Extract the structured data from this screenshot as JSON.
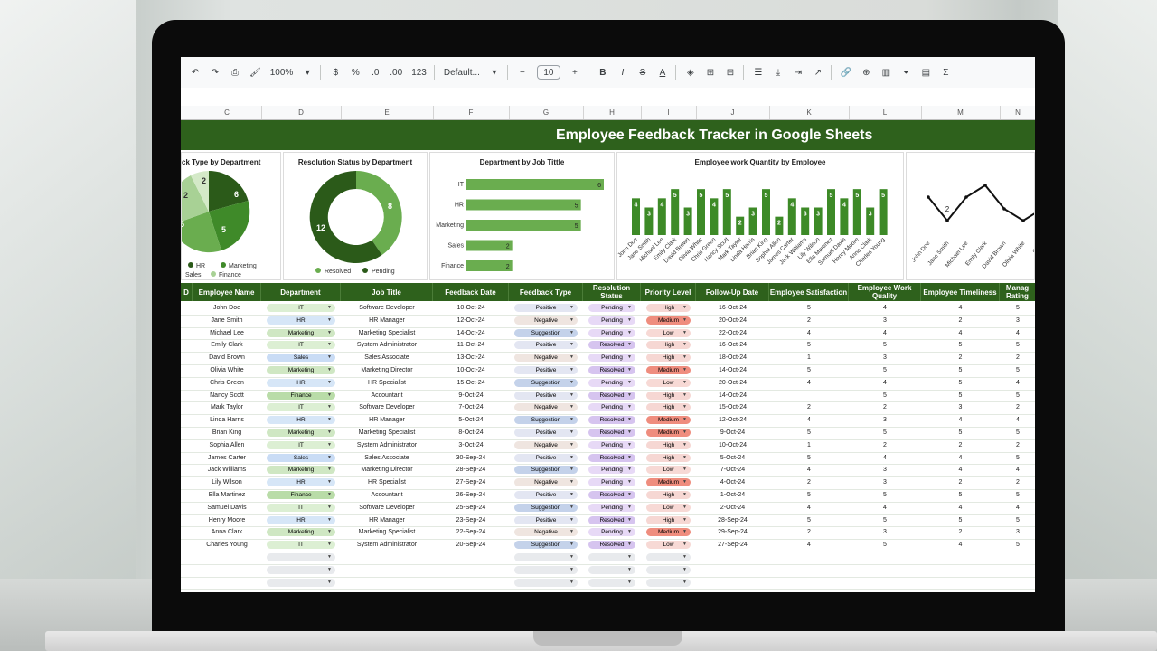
{
  "toolbar": {
    "zoom": "100%",
    "currency": "$",
    "percent": "%",
    "dec_minus": ".0",
    "dec_plus": ".00",
    "num_format": "123",
    "font": "Default...",
    "font_size": "10"
  },
  "columns": [
    {
      "label": "C",
      "w": 76
    },
    {
      "label": "D",
      "w": 88
    },
    {
      "label": "E",
      "w": 102
    },
    {
      "label": "F",
      "w": 84
    },
    {
      "label": "G",
      "w": 82
    },
    {
      "label": "H",
      "w": 64
    },
    {
      "label": "I",
      "w": 61
    },
    {
      "label": "J",
      "w": 81
    },
    {
      "label": "K",
      "w": 88
    },
    {
      "label": "L",
      "w": 80
    },
    {
      "label": "M",
      "w": 87
    },
    {
      "label": "N",
      "w": 40
    }
  ],
  "title": "Employee Feedback Tracker in Google Sheets",
  "charts": [
    {
      "title": "ck Type by Department",
      "type": "pie",
      "labels": [
        "6",
        "5",
        "5",
        "2",
        "2"
      ],
      "legend": [
        "HR",
        "Marketing",
        "Sales",
        "Finance"
      ]
    },
    {
      "title": "Resolution Status by Department",
      "type": "donut",
      "values": [
        8,
        12
      ],
      "legend": [
        "Resolved",
        "Pending"
      ]
    },
    {
      "title": "Department by Job Tittle",
      "type": "bar",
      "categories": [
        "IT",
        "HR",
        "Marketing",
        "Sales",
        "Finance"
      ],
      "values": [
        6,
        5,
        5,
        2,
        2
      ]
    },
    {
      "title": "Employee work Quantity by Employee",
      "type": "column"
    },
    {
      "title": "",
      "type": "line"
    }
  ],
  "chart_data": [
    {
      "type": "column",
      "title": "Employee work Quantity by Employee",
      "categories": [
        "John Doe",
        "Jane Smith",
        "Michael Lee",
        "Emily Clark",
        "David Brown",
        "Olivia White",
        "Chris Green",
        "Nancy Scott",
        "Mark Taylor",
        "Linda Harris",
        "Brian King",
        "Sophia Allen",
        "James Carter",
        "Jack Williams",
        "Lily Wilson",
        "Ella Martinez",
        "Samuel Davis",
        "Henry Moore",
        "Anna Clark",
        "Charles Young"
      ],
      "values": [
        4,
        3,
        4,
        5,
        3,
        5,
        4,
        5,
        2,
        3,
        5,
        2,
        4,
        3,
        3,
        5,
        4,
        5,
        3,
        5
      ],
      "ylim": [
        0,
        6
      ]
    },
    {
      "type": "line",
      "categories": [
        "John Doe",
        "Jane Smith",
        "Michael Lee",
        "Emily Clark",
        "David Brown",
        "Olivia White",
        "Chris"
      ],
      "values": [
        4,
        2,
        4,
        5,
        3,
        2,
        3
      ],
      "labels": [
        "",
        "2",
        "",
        "",
        "",
        "",
        ""
      ]
    }
  ],
  "headers": [
    "D",
    "Employee Name",
    "Department",
    "Job Title",
    "Feedback Date",
    "Feedback Type",
    "Resolution Status",
    "Priority Level",
    "Follow-Up Date",
    "Employee Satisfaction",
    "Employee Work Quality",
    "Employee Timeliness",
    "Manag Rating"
  ],
  "rows": [
    [
      "John Doe",
      "IT",
      "Software Developer",
      "10-Oct-24",
      "Positive",
      "Pending",
      "High",
      "16-Oct-24",
      "5",
      "4",
      "4",
      "5"
    ],
    [
      "Jane Smith",
      "HR",
      "HR Manager",
      "12-Oct-24",
      "Negative",
      "Pending",
      "Medium",
      "20-Oct-24",
      "2",
      "3",
      "2",
      "3"
    ],
    [
      "Michael Lee",
      "Marketing",
      "Marketing Specialist",
      "14-Oct-24",
      "Suggestion",
      "Pending",
      "Low",
      "22-Oct-24",
      "4",
      "4",
      "4",
      "4"
    ],
    [
      "Emily Clark",
      "IT",
      "System Administrator",
      "11-Oct-24",
      "Positive",
      "Resolved",
      "High",
      "16-Oct-24",
      "5",
      "5",
      "5",
      "5"
    ],
    [
      "David Brown",
      "Sales",
      "Sales Associate",
      "13-Oct-24",
      "Negative",
      "Pending",
      "High",
      "18-Oct-24",
      "1",
      "3",
      "2",
      "2"
    ],
    [
      "Olivia White",
      "Marketing",
      "Marketing Director",
      "10-Oct-24",
      "Positive",
      "Resolved",
      "Medium",
      "14-Oct-24",
      "5",
      "5",
      "5",
      "5"
    ],
    [
      "Chris Green",
      "HR",
      "HR Specialist",
      "15-Oct-24",
      "Suggestion",
      "Pending",
      "Low",
      "20-Oct-24",
      "4",
      "4",
      "5",
      "4"
    ],
    [
      "Nancy Scott",
      "Finance",
      "Accountant",
      "9-Oct-24",
      "Positive",
      "Resolved",
      "High",
      "14-Oct-24",
      "",
      "5",
      "5",
      "5"
    ],
    [
      "Mark Taylor",
      "IT",
      "Software Developer",
      "7-Oct-24",
      "Negative",
      "Pending",
      "High",
      "15-Oct-24",
      "2",
      "2",
      "3",
      "2"
    ],
    [
      "Linda Harris",
      "HR",
      "HR Manager",
      "5-Oct-24",
      "Suggestion",
      "Resolved",
      "Medium",
      "12-Oct-24",
      "4",
      "3",
      "4",
      "4"
    ],
    [
      "Brian King",
      "Marketing",
      "Marketing Specialist",
      "8-Oct-24",
      "Positive",
      "Resolved",
      "Medium",
      "9-Oct-24",
      "5",
      "5",
      "5",
      "5"
    ],
    [
      "Sophia Allen",
      "IT",
      "System Administrator",
      "3-Oct-24",
      "Negative",
      "Pending",
      "High",
      "10-Oct-24",
      "1",
      "2",
      "2",
      "2"
    ],
    [
      "James Carter",
      "Sales",
      "Sales Associate",
      "30-Sep-24",
      "Positive",
      "Resolved",
      "High",
      "5-Oct-24",
      "5",
      "4",
      "4",
      "5"
    ],
    [
      "Jack Williams",
      "Marketing",
      "Marketing Director",
      "28-Sep-24",
      "Suggestion",
      "Pending",
      "Low",
      "7-Oct-24",
      "4",
      "3",
      "4",
      "4"
    ],
    [
      "Lily Wilson",
      "HR",
      "HR Specialist",
      "27-Sep-24",
      "Negative",
      "Pending",
      "Medium",
      "4-Oct-24",
      "2",
      "3",
      "2",
      "2"
    ],
    [
      "Ella Martinez",
      "Finance",
      "Accountant",
      "26-Sep-24",
      "Positive",
      "Resolved",
      "High",
      "1-Oct-24",
      "5",
      "5",
      "5",
      "5"
    ],
    [
      "Samuel Davis",
      "IT",
      "Software Developer",
      "25-Sep-24",
      "Suggestion",
      "Pending",
      "Low",
      "2-Oct-24",
      "4",
      "4",
      "4",
      "4"
    ],
    [
      "Henry Moore",
      "HR",
      "HR Manager",
      "23-Sep-24",
      "Positive",
      "Resolved",
      "High",
      "28-Sep-24",
      "5",
      "5",
      "5",
      "5"
    ],
    [
      "Anna Clark",
      "Marketing",
      "Marketing Specialist",
      "22-Sep-24",
      "Negative",
      "Pending",
      "Medium",
      "29-Sep-24",
      "2",
      "3",
      "2",
      "3"
    ],
    [
      "Charles Young",
      "IT",
      "System Administrator",
      "20-Sep-24",
      "Suggestion",
      "Resolved",
      "Low",
      "27-Sep-24",
      "4",
      "5",
      "4",
      "5"
    ]
  ],
  "colors": {
    "brand": "#2e611c",
    "dept": {
      "IT": "#dcefd3",
      "HR": "#d6e6f7",
      "Marketing": "#cfe7c3",
      "Sales": "#c9dcf5",
      "Finance": "#b9dca8"
    },
    "type": {
      "Positive": "#e3e6f2",
      "Negative": "#efe5e0",
      "Suggestion": "#c4d2ea"
    },
    "status": {
      "Pending": "#e7d9f6",
      "Resolved": "#d6c4ef"
    },
    "priority": {
      "High": "#f6d7d3",
      "Medium": "#ef8d7e",
      "Low": "#f7d9d5"
    }
  }
}
